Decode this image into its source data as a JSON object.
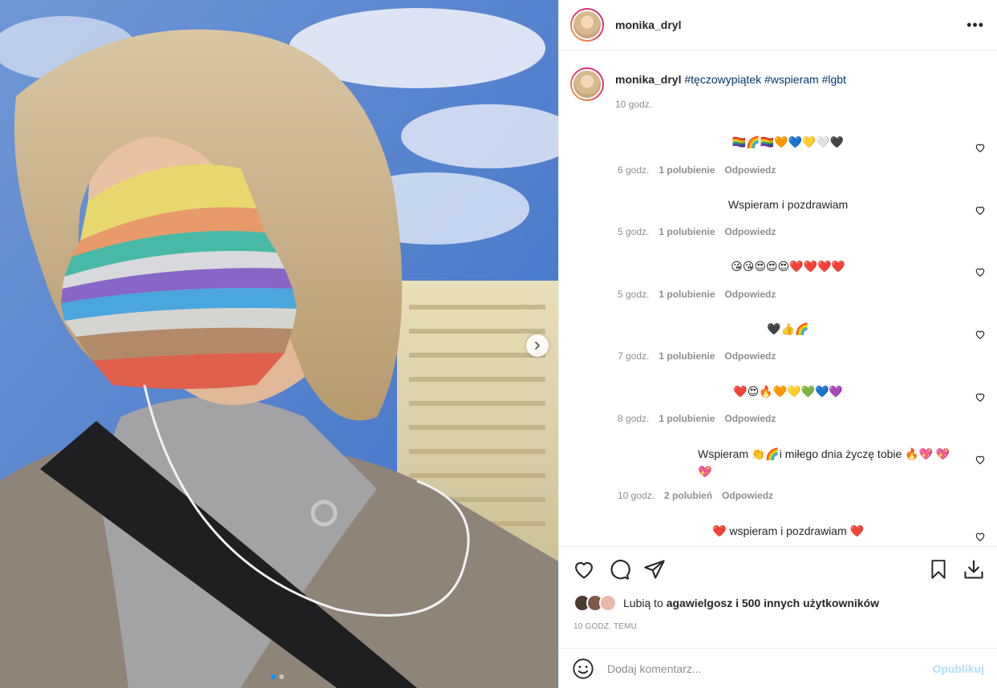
{
  "post": {
    "username": "monika_dryl",
    "more_label": "•••",
    "caption": {
      "username": "monika_dryl",
      "tags": [
        "#tęczowypiątek",
        "#wspieram",
        "#lgbt"
      ],
      "time": "10 godz."
    }
  },
  "comments": [
    {
      "text": "🏳️‍🌈🌈🏳️‍🌈🧡💙💛🤍🖤",
      "time": "6 godz.",
      "likes": "1 polubienie",
      "reply": "Odpowiedz"
    },
    {
      "text": "Wspieram i pozdrawiam",
      "time": "5 godz.",
      "likes": "1 polubienie",
      "reply": "Odpowiedz"
    },
    {
      "text": "😘😘😍😍😍❤️❤️❤️❤️",
      "time": "5 godz.",
      "likes": "1 polubienie",
      "reply": "Odpowiedz"
    },
    {
      "text": "🖤👍🌈",
      "time": "7 godz.",
      "likes": "1 polubienie",
      "reply": "Odpowiedz"
    },
    {
      "text": "❤️😍🔥🧡💛💚💙💜",
      "time": "8 godz.",
      "likes": "1 polubienie",
      "reply": "Odpowiedz"
    },
    {
      "text": "Wspieram 👏🌈i miłego dnia życzę tobie 🔥💖 💖💖",
      "time": "10 godz.",
      "likes": "2 polubień",
      "reply": "Odpowiedz"
    },
    {
      "text": "❤️ wspieram i pozdrawiam ❤️",
      "time": "",
      "likes": "",
      "reply": ""
    }
  ],
  "likes": {
    "prefix": "Lubią to",
    "user": "agawielgosz",
    "suffix": "i 500 innych użytkowników"
  },
  "posted_ago": "10 godz. temu",
  "add_comment": {
    "placeholder": "Dodaj komentarz...",
    "publish": "Opublikuj"
  },
  "colors": {
    "accent": "#0095f6",
    "tag": "#00376b",
    "muted": "#8e8e8e",
    "publish_disabled": "#b2dffc"
  },
  "icons": [
    "like-heart-icon",
    "comment-icon",
    "share-icon",
    "bookmark-icon",
    "download-icon",
    "emoji-icon",
    "chevron-right-icon",
    "more-icon"
  ]
}
